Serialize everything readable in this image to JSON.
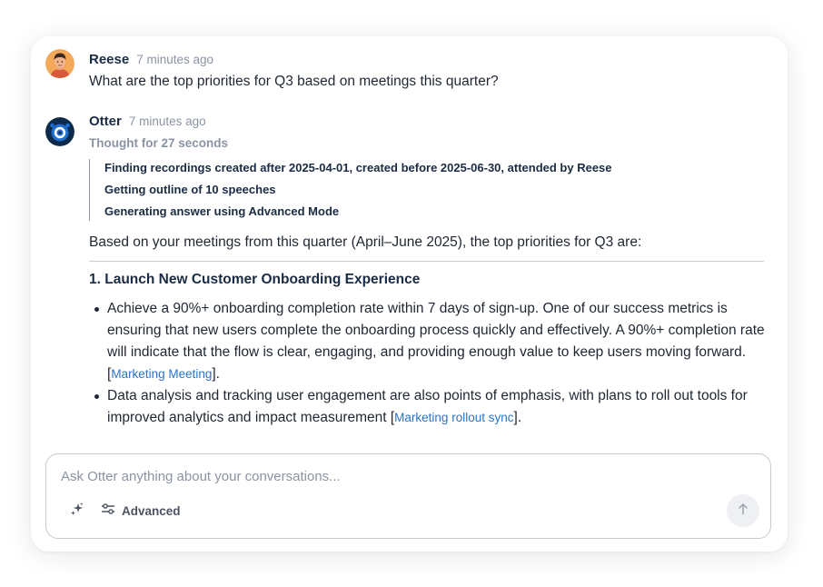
{
  "user_message": {
    "author": "Reese",
    "time": "7 minutes ago",
    "text": "What are the top priorities for Q3 based on meetings this quarter?"
  },
  "assistant_message": {
    "author": "Otter",
    "time": "7 minutes ago",
    "thought_label": "Thought for 27 seconds",
    "steps": [
      "Finding recordings created after 2025-04-01, created before 2025-06-30, attended by Reese",
      "Getting outline of 10 speeches",
      "Generating answer using Advanced Mode"
    ],
    "intro": "Based on your meetings from this quarter (April–June 2025), the top priorities for Q3 are:",
    "section_title": "1. Launch New Customer Onboarding Experience",
    "bullets": [
      {
        "text": "Achieve a 90%+ onboarding completion rate within 7 days of sign-up. One of our success metrics is ensuring that new users complete the onboarding process quickly and effectively. A 90%+ completion rate will indicate that the flow is clear, engaging, and providing enough value to keep users moving forward. [",
        "link": "Marketing Meeting",
        "suffix": "]."
      },
      {
        "text": "Data analysis and tracking user engagement are also points of emphasis, with plans to roll out tools for improved analytics and impact measurement [",
        "link": "Marketing rollout sync",
        "suffix": "]."
      }
    ]
  },
  "composer": {
    "placeholder": "Ask Otter anything about your conversations...",
    "value": "",
    "advanced_label": "Advanced",
    "icons": {
      "sparkle": "sparkle-icon",
      "sliders": "sliders-icon",
      "send": "arrow-up-icon"
    }
  },
  "colors": {
    "link": "#2a73c9",
    "muted_text": "#8a94a3",
    "heading": "#1a2b44",
    "otter_blue": "#1f6fd1",
    "reese_avatar_bg": "#f4a95a"
  }
}
